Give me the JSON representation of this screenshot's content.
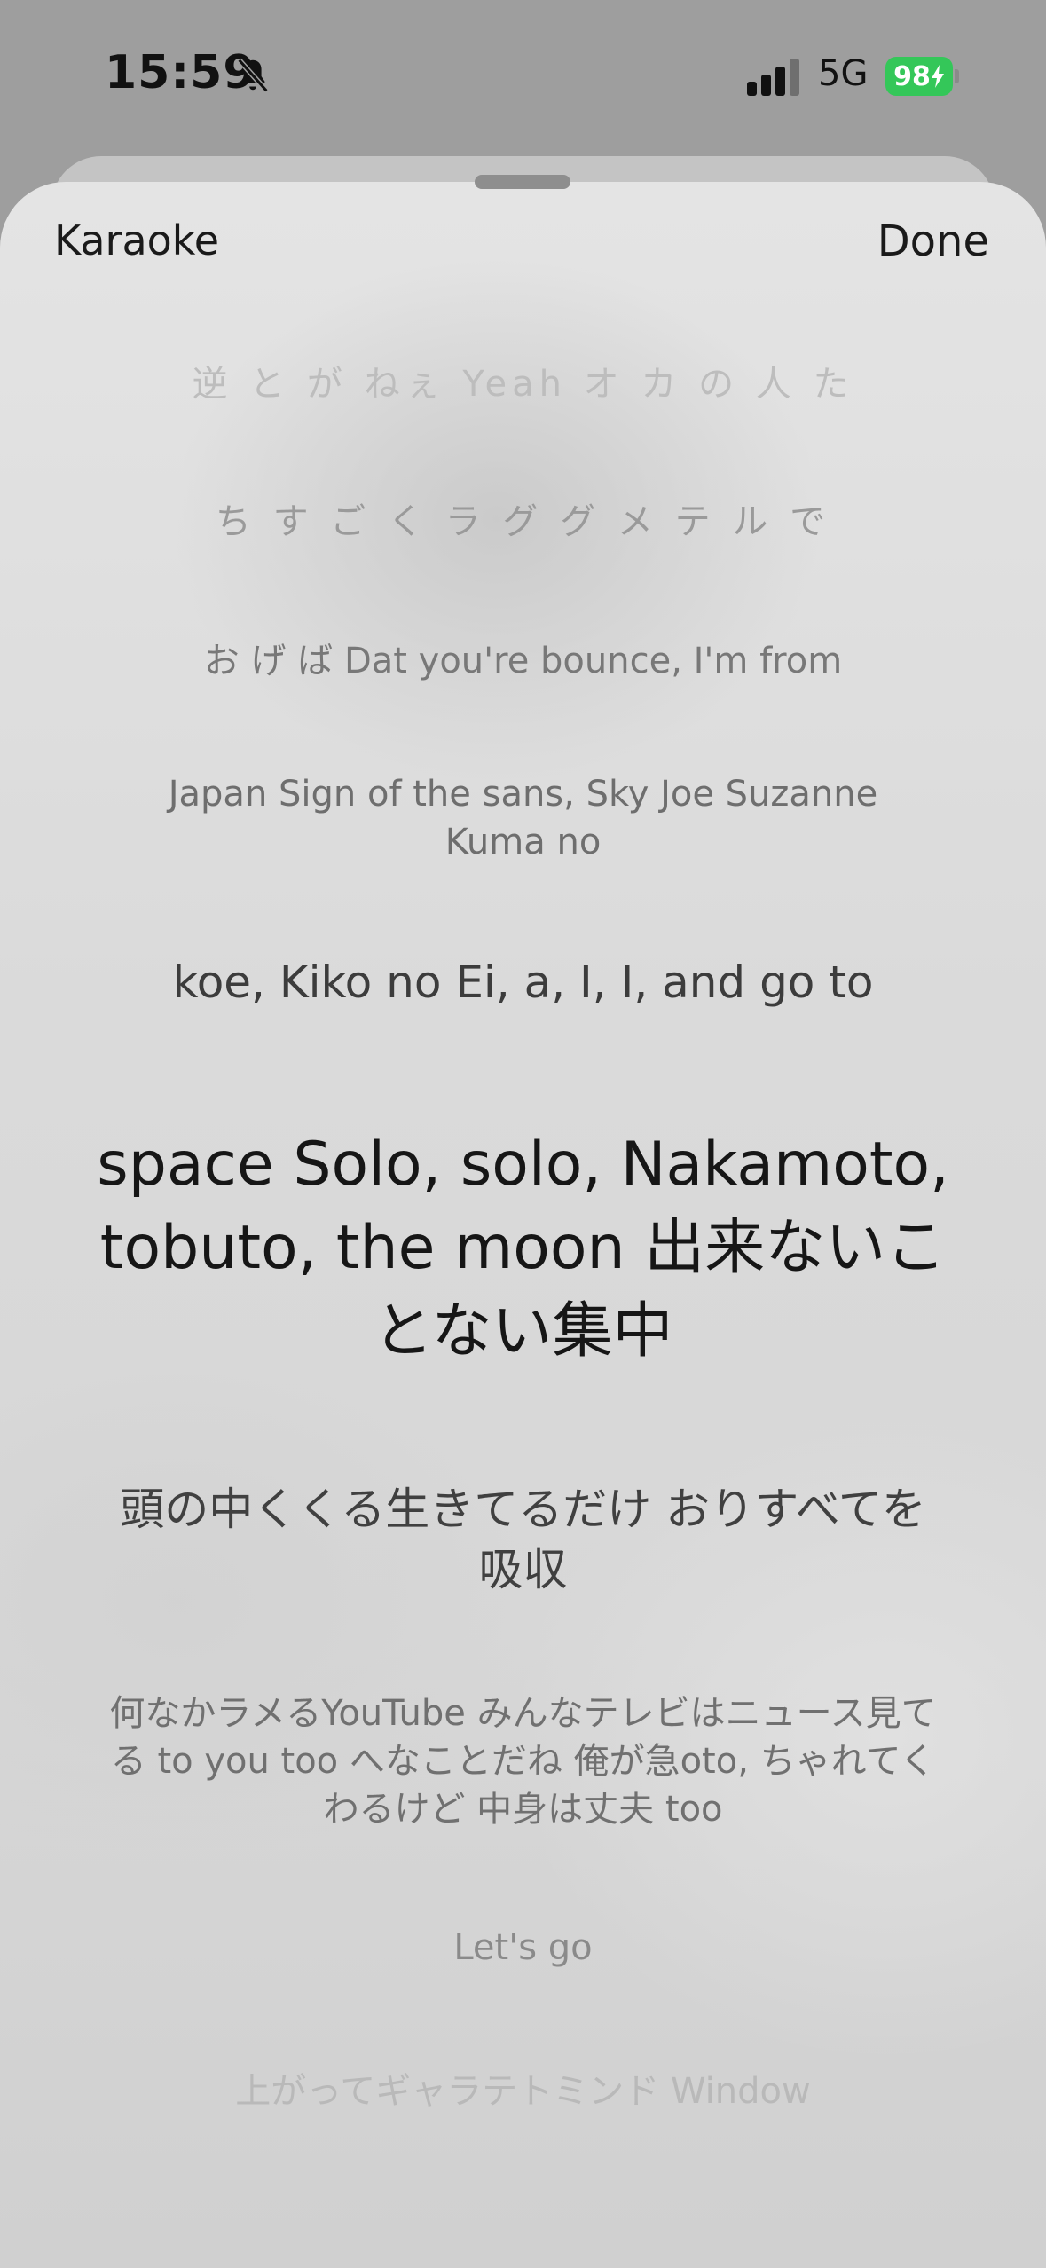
{
  "status_bar": {
    "time": "15:59",
    "network": "5G",
    "battery": "98",
    "battery_color": "#34c759",
    "icons": [
      "bell-slash-icon",
      "cellular-signal-icon",
      "battery-charging-icon"
    ]
  },
  "header": {
    "left_title": "Karaoke",
    "done_label": "Done"
  },
  "lyrics": [
    "逆 と が ねぇ Yeah オ カ の 人 た",
    "ち す ご く ラ グ グ メ テ ル で",
    "お げ ば Dat you're bounce, I'm from",
    "Japan Sign of the sans, Sky Joe Suzanne Kuma no",
    "koe, Kiko no Ei, a, I, I, and go to",
    "space Solo, solo, Nakamoto, tobuto, the moon 出来ないことない集中",
    "頭の中くくる生きてるだけ おりすべてを吸収",
    "何なかラメるYouTube みんなテレビはニュース見てる to you too へなことだね 俺が急oto, ちゃれてくわるけど 中身は丈夫 too",
    "Let's go",
    "上がってギャラテトミンド Window"
  ],
  "current_line_index": 5
}
